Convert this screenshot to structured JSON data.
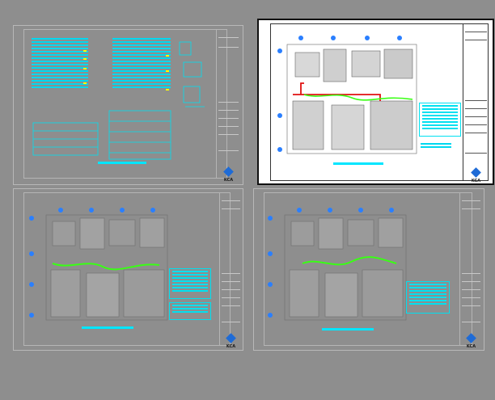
{
  "sheets": [
    {
      "name": "legend-schedule-sheet",
      "logo_text": "KCA"
    },
    {
      "name": "floor-plan-sheet-active",
      "logo_text": "KCA"
    },
    {
      "name": "floor-plan-sheet-lower-left",
      "logo_text": "KCA"
    },
    {
      "name": "floor-plan-sheet-lower-right",
      "logo_text": "KCA"
    }
  ],
  "colors": {
    "workspace": "#8e8e8e",
    "sheet_border": "#b8b8b8",
    "cyan": "#00e6ff",
    "green_route": "#39ff14",
    "red_route": "#e01010",
    "grid_bubble": "#2a7fff",
    "logo": "#1e6bd6"
  }
}
